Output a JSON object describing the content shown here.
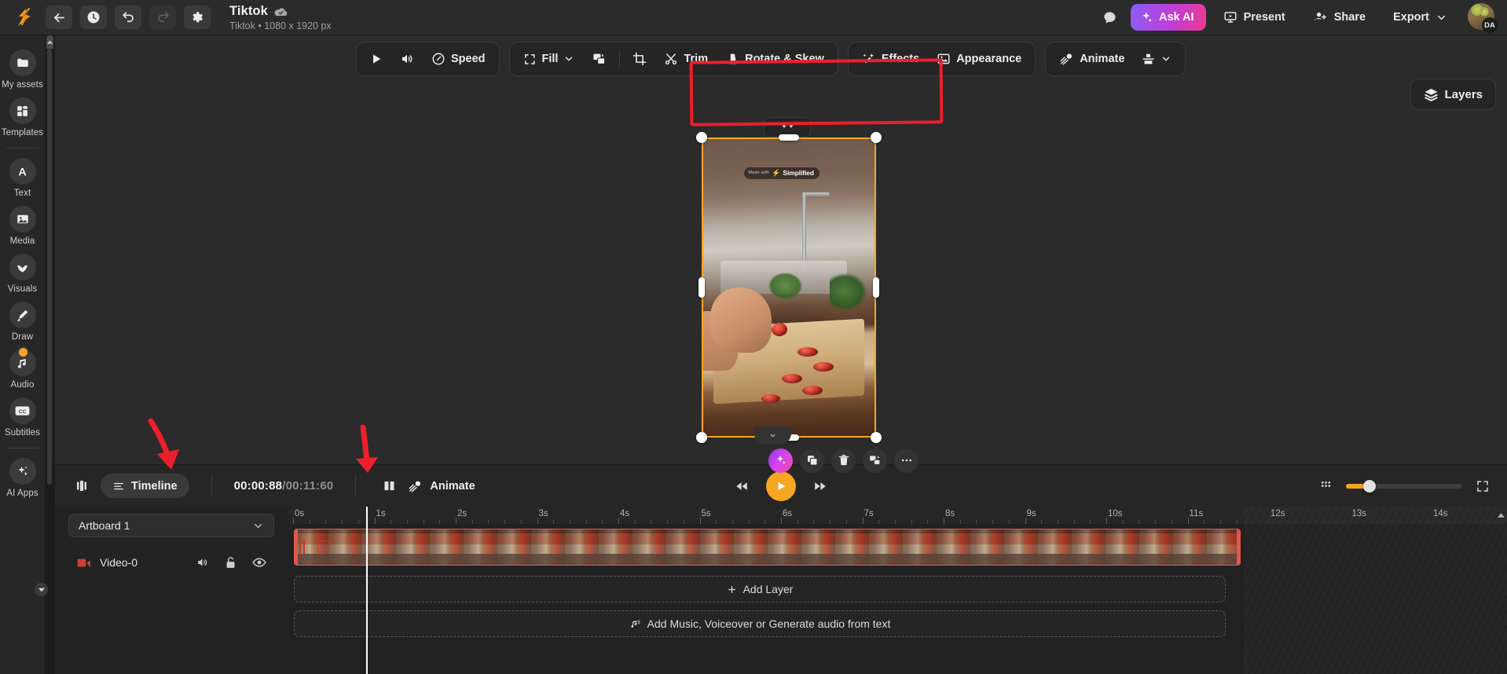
{
  "app": {
    "name": "Simplified Video Editor",
    "accent_orange": "#f5a623",
    "annotation_red": "#ee1f2b",
    "clip_red": "#e0584a"
  },
  "topbar": {
    "logo": "simplified-logo",
    "back_icon": "back-arrow-icon",
    "history_icon": "clock-history-icon",
    "undo_icon": "undo-icon",
    "redo_icon": "redo-icon",
    "settings_icon": "gear-icon",
    "doc_title": "Tiktok",
    "doc_sync_icon": "cloud-synced-icon",
    "doc_subtitle": "Tiktok • 1080 x 1920 px",
    "comment_icon": "comment-bubble-icon",
    "ask_ai_label": "Ask AI",
    "ask_ai_icon": "sparkle-icon",
    "present_label": "Present",
    "present_icon": "present-screen-icon",
    "share_label": "Share",
    "share_icon": "person-add-icon",
    "export_label": "Export",
    "export_caret_icon": "chevron-down-icon",
    "avatar_initials": "DA"
  },
  "sidebar": {
    "items": [
      {
        "label": "My assets",
        "icon": "folder-icon"
      },
      {
        "label": "Templates",
        "icon": "grid-layout-icon"
      },
      {
        "label": "Text",
        "icon": "letter-a-icon"
      },
      {
        "label": "Media",
        "icon": "image-icon"
      },
      {
        "label": "Visuals",
        "icon": "leaf-icon"
      },
      {
        "label": "Draw",
        "icon": "pen-brush-icon"
      },
      {
        "label": "Audio",
        "icon": "music-note-icon"
      },
      {
        "label": "Subtitles",
        "icon": "closed-caption-icon"
      },
      {
        "label": "AI Apps",
        "icon": "sparkles-icon"
      }
    ],
    "collapse_icon": "chevron-down-icon"
  },
  "canvas_toolbar": {
    "group1": [
      {
        "label": "",
        "icon": "play-icon",
        "name": "preview-play-button"
      },
      {
        "label": "",
        "icon": "volume-icon",
        "name": "volume-button"
      },
      {
        "label": "Speed",
        "icon": "speedometer-icon",
        "name": "speed-button"
      }
    ],
    "group2": [
      {
        "label": "Fill",
        "icon": "fit-frame-icon",
        "caret": "chevron-down-icon",
        "name": "fill-button"
      },
      {
        "label": "",
        "icon": "replace-media-icon",
        "name": "replace-media-button"
      },
      {
        "label": "",
        "icon": "crop-icon",
        "name": "crop-button"
      },
      {
        "label": "Trim",
        "icon": "scissors-icon",
        "name": "trim-button"
      },
      {
        "label": "Rotate & Skew",
        "icon": "rotate-skew-icon",
        "name": "rotate-skew-button"
      }
    ],
    "group3": [
      {
        "label": "Effects",
        "icon": "magic-wand-icon",
        "name": "effects-button"
      },
      {
        "label": "Appearance",
        "icon": "picture-adjust-icon",
        "name": "appearance-button"
      }
    ],
    "group4": [
      {
        "label": "Animate",
        "icon": "animate-icon",
        "name": "animate-button"
      },
      {
        "label": "",
        "icon": "align-icon",
        "caret": "chevron-down-icon",
        "name": "align-button"
      }
    ],
    "layers_label": "Layers",
    "layers_icon": "layers-stack-icon"
  },
  "canvas": {
    "watermark_made": "Made with",
    "watermark_brand": "Simplified",
    "rotate_handle_icon": "rotate-handle-icon",
    "collapse_icon": "chevron-down-icon",
    "float_tools": [
      {
        "icon": "ai-sparkle-icon",
        "name": "ai-edit-button"
      },
      {
        "icon": "duplicate-icon",
        "name": "duplicate-button"
      },
      {
        "icon": "trash-icon",
        "name": "delete-button"
      },
      {
        "icon": "replace-image-icon",
        "name": "replace-button"
      },
      {
        "icon": "more-dots-icon",
        "name": "more-options-button"
      }
    ]
  },
  "timeline_bar": {
    "split_view_icon": "split-view-icon",
    "timeline_label": "Timeline",
    "timeline_icon": "list-lines-icon",
    "current_time": "00:00:88",
    "separator": "/",
    "total_time": "00:11:60",
    "keyframe_icon": "keyframe-split-icon",
    "animate_label": "Animate",
    "animate_icon": "animate-icon",
    "rewind_icon": "rewind-icon",
    "play_icon": "play-icon",
    "forward_icon": "fast-forward-icon",
    "grid_icon": "grid-dots-icon",
    "zoom_value": 19,
    "fullscreen_icon": "fullscreen-icon"
  },
  "timeline": {
    "artboard_label": "Artboard 1",
    "artboard_caret_icon": "chevron-down-icon",
    "layer": {
      "name": "Video-0",
      "type_icon": "video-clip-icon",
      "mute_icon": "volume-icon",
      "lock_icon": "unlock-icon",
      "visibility_icon": "eye-icon"
    },
    "ruler_ticks": [
      "0s",
      "1s",
      "2s",
      "3s",
      "4s",
      "5s",
      "6s",
      "7s",
      "8s",
      "9s",
      "10s",
      "11s",
      "12s",
      "13s",
      "14s"
    ],
    "playhead_time_s": 0.88,
    "clip_start_s": 0,
    "clip_end_s": 11.6,
    "hatched_start_s": 11.73,
    "add_layer_label": "Add Layer",
    "add_layer_icon": "plus-icon",
    "add_music_label": "Add Music, Voiceover or Generate audio from text",
    "add_music_icon": "audio-wave-icon",
    "scroll_icon": "caret-up-icon"
  },
  "annotations": {
    "highlight_box": "red-rectangle-around-crop-trim-rotate",
    "arrow_timeline": "red-arrow-pointing-to-timeline-toggle",
    "arrow_keyframe": "red-arrow-pointing-to-keyframe-button"
  }
}
